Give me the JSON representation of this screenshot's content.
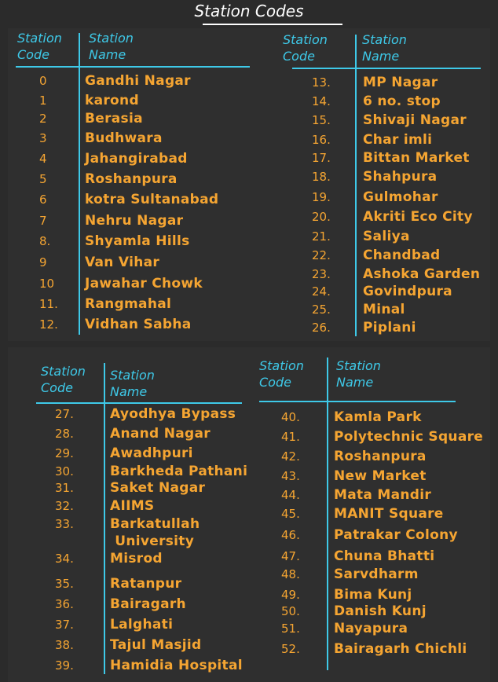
{
  "title": "Station Codes",
  "headers": {
    "code": "Station\nCode",
    "name": "Station\nName"
  },
  "colors": {
    "background": "#2b2b2b",
    "accent": "#3ec9e8",
    "text": "#f5a532"
  },
  "tables": [
    {
      "id": "t1",
      "rows": [
        {
          "code": "0",
          "name": "Gandhi Nagar"
        },
        {
          "code": "1",
          "name": "karond"
        },
        {
          "code": "2",
          "name": "Berasia"
        },
        {
          "code": "3",
          "name": "Budhwara"
        },
        {
          "code": "4",
          "name": "Jahangirabad"
        },
        {
          "code": "5",
          "name": "Roshanpura"
        },
        {
          "code": "6",
          "name": "kotra Sultanabad"
        },
        {
          "code": "7",
          "name": "Nehru Nagar"
        },
        {
          "code": "8.",
          "name": "Shyamla Hills"
        },
        {
          "code": "9",
          "name": "Van Vihar"
        },
        {
          "code": "10",
          "name": "Jawahar Chowk"
        },
        {
          "code": "11.",
          "name": "Rangmahal"
        },
        {
          "code": "12.",
          "name": "Vidhan Sabha"
        }
      ]
    },
    {
      "id": "t2",
      "rows": [
        {
          "code": "13.",
          "name": "MP Nagar"
        },
        {
          "code": "14.",
          "name": "6 no. stop"
        },
        {
          "code": "15.",
          "name": "Shivaji Nagar"
        },
        {
          "code": "16.",
          "name": "Char imli"
        },
        {
          "code": "17.",
          "name": "Bittan Market"
        },
        {
          "code": "18.",
          "name": "Shahpura"
        },
        {
          "code": "19.",
          "name": "Gulmohar"
        },
        {
          "code": "20.",
          "name": "Akriti Eco City"
        },
        {
          "code": "21.",
          "name": "Saliya"
        },
        {
          "code": "22.",
          "name": "Chandbad"
        },
        {
          "code": "23.",
          "name": "Ashoka Garden"
        },
        {
          "code": "24.",
          "name": "Govindpura"
        },
        {
          "code": "25.",
          "name": "Minal"
        },
        {
          "code": "26.",
          "name": "Piplani"
        }
      ]
    },
    {
      "id": "t3",
      "rows": [
        {
          "code": "27.",
          "name": "Ayodhya Bypass"
        },
        {
          "code": "28.",
          "name": "Anand Nagar"
        },
        {
          "code": "29.",
          "name": "Awadhpuri"
        },
        {
          "code": "30.",
          "name": "Barkheda Pathani"
        },
        {
          "code": "31.",
          "name": "Saket Nagar"
        },
        {
          "code": "32.",
          "name": "AIIMS"
        },
        {
          "code": "33.",
          "name": "Barkatullah\n University"
        },
        {
          "code": "34.",
          "name": "Misrod"
        },
        {
          "code": "35.",
          "name": "Ratanpur"
        },
        {
          "code": "36.",
          "name": "Bairagarh"
        },
        {
          "code": "37.",
          "name": "Lalghati"
        },
        {
          "code": "38.",
          "name": "Tajul Masjid"
        },
        {
          "code": "39.",
          "name": "Hamidia Hospital"
        }
      ]
    },
    {
      "id": "t4",
      "rows": [
        {
          "code": "40.",
          "name": "Kamla Park"
        },
        {
          "code": "41.",
          "name": "Polytechnic Square"
        },
        {
          "code": "42.",
          "name": "Roshanpura"
        },
        {
          "code": "43.",
          "name": "New Market"
        },
        {
          "code": "44.",
          "name": "Mata Mandir"
        },
        {
          "code": "45.",
          "name": "MANIT Square"
        },
        {
          "code": "46.",
          "name": "Patrakar Colony"
        },
        {
          "code": "47.",
          "name": "Chuna Bhatti"
        },
        {
          "code": "48.",
          "name": "Sarvdharm"
        },
        {
          "code": "49.",
          "name": "Bima Kunj"
        },
        {
          "code": "50.",
          "name": "Danish Kunj"
        },
        {
          "code": "51.",
          "name": "Nayapura"
        },
        {
          "code": "52.",
          "name": "Bairagarh Chichli"
        }
      ]
    }
  ]
}
